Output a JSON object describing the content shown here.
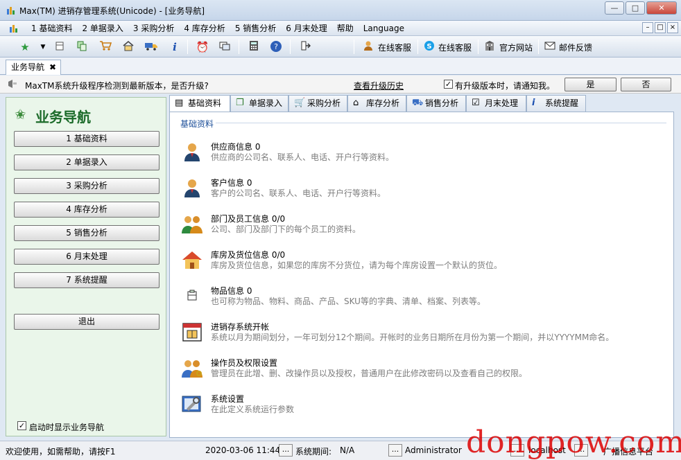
{
  "window": {
    "title": "Max(TM) 进销存管理系统(Unicode) - [业务导航]",
    "controls": {
      "minimize": "—",
      "maximize": "□",
      "close": "✕"
    }
  },
  "menubar": {
    "items": [
      "1 基础资料",
      "2 单据录入",
      "3 采购分析",
      "4 库存分析",
      "5 销售分析",
      "6 月末处理",
      "帮助",
      "Language"
    ],
    "mdi_controls": {
      "minimize": "–",
      "restore": "□",
      "close": "×"
    }
  },
  "toolbar": {
    "online_service_1": "在线客服",
    "online_service_2": "在线客服",
    "official_site": "官方网站",
    "mail_feedback": "邮件反馈"
  },
  "doc_tab": {
    "label": "业务导航",
    "close": "✖"
  },
  "infobar": {
    "message": "MaxTM系统升级程序检测到最新版本，是否升级?",
    "history_link": "查看升级历史",
    "notify_checked": "✓",
    "notify_label": "有升级版本时，请通知我。",
    "yes": "是",
    "no": "否"
  },
  "leftnav": {
    "title": "业务导航",
    "buttons": [
      "1 基础资料",
      "2 单据录入",
      "3 采购分析",
      "4 库存分析",
      "5 销售分析",
      "6 月末处理",
      "7 系统提醒"
    ],
    "exit": "退出",
    "startup_checked": "✓",
    "startup_label": "启动时显示业务导航"
  },
  "tabs": [
    "基础资料",
    "单据录入",
    "采购分析",
    "库存分析",
    "销售分析",
    "月末处理",
    "系统提醒"
  ],
  "content": {
    "group_title": "基础资料",
    "items": [
      {
        "title": "供应商信息 0",
        "desc": "供应商的公司名、联系人、电话、开户行等资料。",
        "icon": "person-icon"
      },
      {
        "title": "客户信息 0",
        "desc": "客户的公司名、联系人、电话、开户行等资料。",
        "icon": "person-icon"
      },
      {
        "title": "部门及员工信息 0/0",
        "desc": "公司、部门及部门下的每个员工的资料。",
        "icon": "group-icon"
      },
      {
        "title": "库房及货位信息 0/0",
        "desc": "库房及货位信息，如果您的库房不分货位，请为每个库房设置一个默认的货位。",
        "icon": "house-icon"
      },
      {
        "title": "物品信息 0",
        "desc": "也可称为物品、物料、商品、产品、SKU等的字典、清单、档案、列表等。",
        "icon": "box-icon"
      },
      {
        "title": "进销存系统开帐",
        "desc": "系统以月为期间划分，一年可划分12个期间。开帐时的业务日期所在月份为第一个期间，并以YYYYMM命名。",
        "icon": "calendar-icon"
      },
      {
        "title": "操作员及权限设置",
        "desc": "管理员在此增、删、改操作员以及授权，普通用户在此修改密码以及查看自己的权限。",
        "icon": "users-key-icon"
      },
      {
        "title": "系统设置",
        "desc": "在此定义系统运行参数",
        "icon": "settings-icon"
      }
    ]
  },
  "statusbar": {
    "help": "欢迎使用，如需帮助，请按F1",
    "datetime": "2020-03-06 11:44",
    "period_label": "系统期间:",
    "period_value": "N/A",
    "user": "Administrator",
    "host": "localhost",
    "broadcast": "广播信息平台",
    "more": "..."
  },
  "watermark": "dongpow.com"
}
